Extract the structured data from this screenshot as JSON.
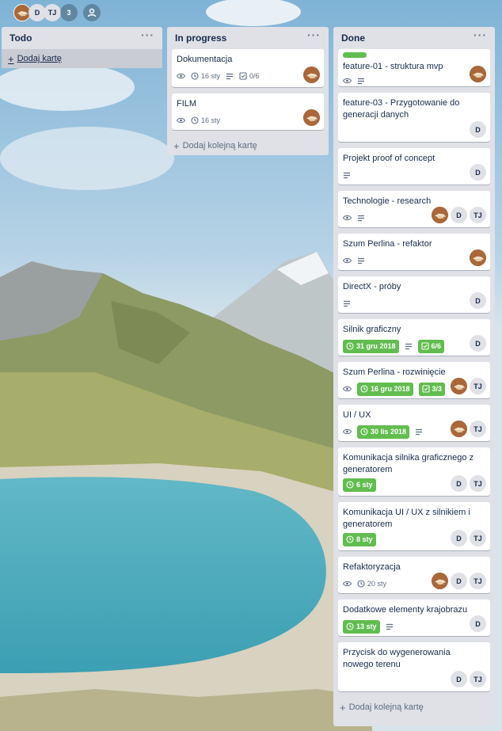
{
  "members": {
    "d": "D",
    "tj": "TJ",
    "more_count": "3"
  },
  "lists": {
    "todo": {
      "title": "Todo",
      "add_label": "Dodaj kartę"
    },
    "progress": {
      "title": "In progress",
      "add_label": "Dodaj kolejną kartę",
      "cards": [
        {
          "title": "Dokumentacja",
          "due": "16 sty",
          "checklist": "0/6"
        },
        {
          "title": "FILM",
          "due": "16 sty"
        }
      ]
    },
    "done": {
      "title": "Done",
      "add_label": "Dodaj kolejną kartę",
      "cards": [
        {
          "title": "feature-01 - struktura mvp"
        },
        {
          "title": "feature-03 - Przygotowanie do generacji danych",
          "m1": "D"
        },
        {
          "title": "Projekt proof of concept",
          "m1": "D"
        },
        {
          "title": "Technologie - research",
          "m1": "D",
          "m2": "TJ"
        },
        {
          "title": "Szum Perlina - refaktor"
        },
        {
          "title": "DirectX - próby",
          "m1": "D"
        },
        {
          "title": "Silnik graficzny",
          "due": "31 gru 2018",
          "checklist": "6/6",
          "m1": "D"
        },
        {
          "title": "Szum Perlina - rozwinięcie",
          "due": "16 gru 2018",
          "checklist": "3/3",
          "m2": "TJ"
        },
        {
          "title": "UI / UX",
          "due": "30 lis 2018",
          "m2": "TJ"
        },
        {
          "title": "Komunikacja silnika graficznego z generatorem",
          "due": "6 sty",
          "m1": "D",
          "m2": "TJ"
        },
        {
          "title": "Komunikacja UI / UX z silnikiem i generatorem",
          "due": "8 sty",
          "m1": "D",
          "m2": "TJ"
        },
        {
          "title": "Refaktoryzacja",
          "due": "20 sty",
          "m1": "D",
          "m2": "TJ"
        },
        {
          "title": "Dodatkowe elementy krajobrazu",
          "due": "13 sty",
          "m1": "D"
        },
        {
          "title": "Przycisk do wygenerowania nowego terenu",
          "m1": "D",
          "m2": "TJ"
        }
      ]
    }
  },
  "colors": {
    "list_bg": "#dfe1e6",
    "green": "#61bd4f",
    "avatar": "#a9673a"
  },
  "icons": [
    "eye-icon",
    "clock-icon",
    "description-icon",
    "checklist-icon",
    "plus-icon",
    "menu-dots-icon",
    "add-member-icon"
  ]
}
